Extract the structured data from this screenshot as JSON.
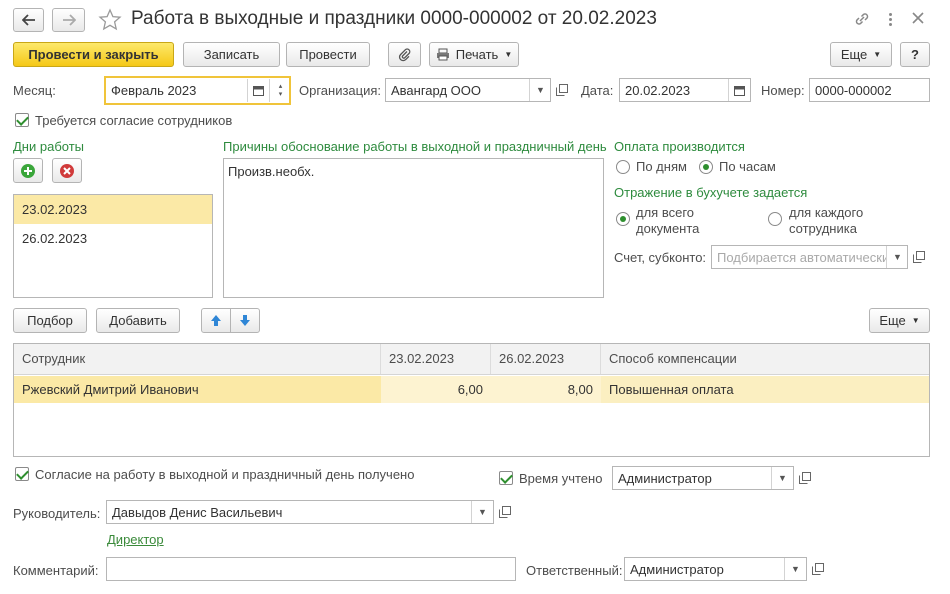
{
  "window": {
    "title": "Работа в выходные и праздники 0000-000002 от 20.02.2023"
  },
  "toolbar": {
    "post_close": "Провести и закрыть",
    "save": "Записать",
    "post": "Провести",
    "print": "Печать",
    "more": "Еще",
    "help": "?"
  },
  "header": {
    "month_label": "Месяц:",
    "month_value": "Февраль 2023",
    "org_label": "Организация:",
    "org_value": "Авангард ООО",
    "date_label": "Дата:",
    "date_value": "20.02.2023",
    "number_label": "Номер:",
    "number_value": "0000-000002",
    "consent_required": "Требуется согласие сотрудников"
  },
  "days": {
    "title": "Дни работы",
    "items": [
      "23.02.2023",
      "26.02.2023"
    ]
  },
  "reasons": {
    "title": "Причины обоснование работы в выходной и праздничный день",
    "text": "Произв.необх."
  },
  "payment": {
    "title": "Оплата производится",
    "by_days": "По дням",
    "by_hours": "По часам",
    "accounting_title": "Отражение в бухучете задается",
    "whole_doc": "для всего документа",
    "each_employee": "для каждого сотрудника",
    "account_label": "Счет, субконто:",
    "account_placeholder": "Подбирается автоматически"
  },
  "table_toolbar": {
    "pick": "Подбор",
    "add": "Добавить",
    "more": "Еще"
  },
  "table": {
    "columns": [
      "Сотрудник",
      "23.02.2023",
      "26.02.2023",
      "Способ компенсации"
    ],
    "rows": [
      {
        "employee": "Ржевский Дмитрий Иванович",
        "d1": "6,00",
        "d2": "8,00",
        "compensation": "Повышенная оплата"
      }
    ]
  },
  "footer": {
    "consent_received": "Согласие на работу в выходной и праздничный день получено",
    "time_counted": "Время учтено",
    "time_counted_by": "Администратор",
    "manager_label": "Руководитель:",
    "manager_value": "Давыдов Денис Васильевич",
    "manager_position": "Директор",
    "comment_label": "Комментарий:",
    "comment_value": "",
    "responsible_label": "Ответственный:",
    "responsible_value": "Администратор"
  },
  "colors": {
    "accent_yellow": "#f5c817",
    "selected_row": "#fbe9a6",
    "group_title_green": "#2e8b3e"
  }
}
